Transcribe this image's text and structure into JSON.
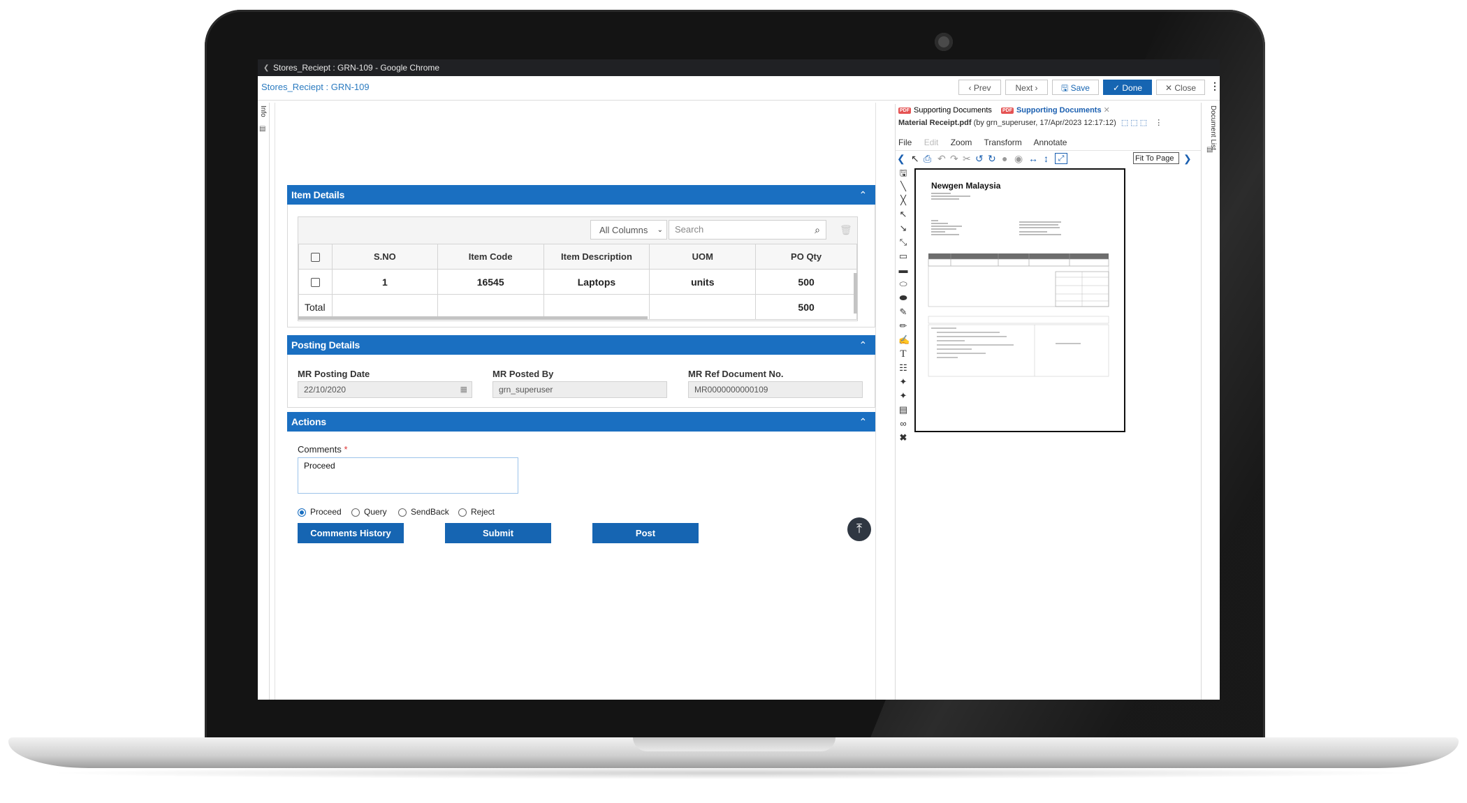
{
  "window": {
    "title": "Stores_Reciept : GRN-109 - Google Chrome"
  },
  "header": {
    "title": "Stores_Reciept : GRN-109",
    "buttons": {
      "prev": "Prev",
      "next": "Next",
      "save": "Save",
      "done": "Done",
      "close": "Close"
    }
  },
  "side_tabs": {
    "info": "Info",
    "document_list": "Document List"
  },
  "item_details": {
    "title": "Item Details",
    "column_select": "All Columns",
    "search_placeholder": "Search",
    "columns": [
      "S.NO",
      "Item Code",
      "Item Description",
      "UOM",
      "PO Qty"
    ],
    "rows": [
      {
        "sno": "1",
        "item_code": "16545",
        "item_description": "Laptops",
        "uom": "units",
        "po_qty": "500"
      }
    ],
    "total_label": "Total",
    "total_po_qty": "500"
  },
  "posting_details": {
    "title": "Posting Details",
    "mr_posting_date_label": "MR Posting Date",
    "mr_posting_date": "22/10/2020",
    "mr_posted_by_label": "MR Posted By",
    "mr_posted_by": "grn_superuser",
    "mr_ref_doc_label": "MR Ref Document No.",
    "mr_ref_doc": "MR0000000000109"
  },
  "actions": {
    "title": "Actions",
    "comments_label": "Comments",
    "comments_required": "*",
    "comments_value": "Proceed",
    "decisions": [
      "Proceed",
      "Query",
      "SendBack",
      "Reject"
    ],
    "selected_decision": "Proceed",
    "comments_history_button": "Comments History",
    "submit_button": "Submit",
    "post_button": "Post"
  },
  "viewer": {
    "tabs": [
      "Supporting Documents",
      "Supporting Documents"
    ],
    "active_tab_index": 1,
    "file_name": "Material Receipt.pdf",
    "file_meta": "(by grn_superuser, 17/Apr/2023 12:17:12)",
    "menu": [
      "File",
      "Edit",
      "Zoom",
      "Transform",
      "Annotate"
    ],
    "fit_option": "Fit To Page",
    "page_company": "Newgen Malaysia"
  },
  "colors": {
    "accent": "#1a6fc1",
    "button": "#1665b2",
    "link": "#2b7bc0",
    "pdf_badge": "#e55353"
  }
}
